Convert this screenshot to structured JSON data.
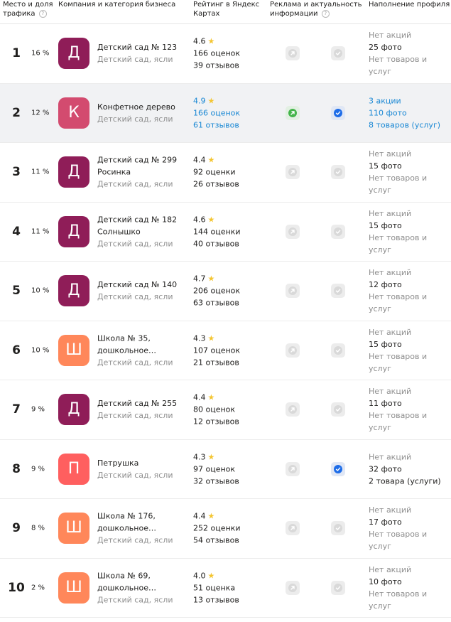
{
  "header": {
    "place_share": "Место и доля трафика",
    "company": "Компания и категория бизнеса",
    "rating": "Рейтинг в Яндекс Картах",
    "ads": "Реклама и актуальность информации",
    "profile": "Наполнение профиля",
    "help_icon": "question-icon"
  },
  "colors": {
    "purple": "#8f1d58",
    "pink": "#d34b6f",
    "orange": "#ff875a",
    "coral": "#ff5f5f",
    "link_blue": "#1a88d4",
    "highlight_bg": "#f1f2f4"
  },
  "rows": [
    {
      "place": "1",
      "share": "16 %",
      "letter": "Д",
      "color": "#8f1d58",
      "name": "Детский сад № 123",
      "category": "Детский сад, ясли",
      "score": "4.6",
      "ratings": "166 оценок",
      "reviews": "39 отзывов",
      "promo": "Нет акций",
      "photos": "25 фото",
      "goods": "Нет товаров и услуг",
      "ad_active": false,
      "verified": false,
      "highlight": false
    },
    {
      "place": "2",
      "share": "12 %",
      "letter": "К",
      "color": "#d34b6f",
      "name": "Конфетное дерево",
      "category": "Детский сад, ясли",
      "score": "4.9",
      "ratings": "166 оценок",
      "reviews": "61 отзывов",
      "promo": "3 акции",
      "photos": "110 фото",
      "goods": "8 товаров (услуг)",
      "ad_active": true,
      "verified": true,
      "highlight": true
    },
    {
      "place": "3",
      "share": "11 %",
      "letter": "Д",
      "color": "#8f1d58",
      "name": "Детский сад № 299 Росинка",
      "category": "Детский сад, ясли",
      "score": "4.4",
      "ratings": "92 оценки",
      "reviews": "26 отзывов",
      "promo": "Нет акций",
      "photos": "15 фото",
      "goods": "Нет товаров и услуг",
      "ad_active": false,
      "verified": false,
      "highlight": false
    },
    {
      "place": "4",
      "share": "11 %",
      "letter": "Д",
      "color": "#8f1d58",
      "name": "Детский сад № 182 Солнышко",
      "category": "Детский сад, ясли",
      "score": "4.6",
      "ratings": "144 оценки",
      "reviews": "40 отзывов",
      "promo": "Нет акций",
      "photos": "15 фото",
      "goods": "Нет товаров и услуг",
      "ad_active": false,
      "verified": false,
      "highlight": false
    },
    {
      "place": "5",
      "share": "10 %",
      "letter": "Д",
      "color": "#8f1d58",
      "name": "Детский сад № 140",
      "category": "Детский сад, ясли",
      "score": "4.7",
      "ratings": "206 оценок",
      "reviews": "63 отзывов",
      "promo": "Нет акций",
      "photos": "12 фото",
      "goods": "Нет товаров и услуг",
      "ad_active": false,
      "verified": false,
      "highlight": false
    },
    {
      "place": "6",
      "share": "10 %",
      "letter": "Ш",
      "color": "#ff875a",
      "name": "Школа № 35, дошкольное…",
      "category": "Детский сад, ясли",
      "score": "4.3",
      "ratings": "107 оценок",
      "reviews": "21 отзывов",
      "promo": "Нет акций",
      "photos": "15 фото",
      "goods": "Нет товаров и услуг",
      "ad_active": false,
      "verified": false,
      "highlight": false
    },
    {
      "place": "7",
      "share": "9 %",
      "letter": "Д",
      "color": "#8f1d58",
      "name": "Детский сад № 255",
      "category": "Детский сад, ясли",
      "score": "4.4",
      "ratings": "80 оценок",
      "reviews": "12 отзывов",
      "promo": "Нет акций",
      "photos": "11 фото",
      "goods": "Нет товаров и услуг",
      "ad_active": false,
      "verified": false,
      "highlight": false
    },
    {
      "place": "8",
      "share": "9 %",
      "letter": "П",
      "color": "#ff5f5f",
      "name": "Петрушка",
      "category": "Детский сад, ясли",
      "score": "4.3",
      "ratings": "97 оценок",
      "reviews": "32 отзывов",
      "promo": "Нет акций",
      "photos": "32 фото",
      "goods": "2 товара (услуги)",
      "ad_active": false,
      "verified": true,
      "highlight": false
    },
    {
      "place": "9",
      "share": "8 %",
      "letter": "Ш",
      "color": "#ff875a",
      "name": "Школа № 176, дошкольное…",
      "category": "Детский сад, ясли",
      "score": "4.4",
      "ratings": "252 оценки",
      "reviews": "54 отзывов",
      "promo": "Нет акций",
      "photos": "17 фото",
      "goods": "Нет товаров и услуг",
      "ad_active": false,
      "verified": false,
      "highlight": false
    },
    {
      "place": "10",
      "share": "2 %",
      "letter": "Ш",
      "color": "#ff875a",
      "name": "Школа № 69, дошкольное…",
      "category": "Детский сад, ясли",
      "score": "4.0",
      "ratings": "51 оценка",
      "reviews": "13 отзывов",
      "promo": "Нет акций",
      "photos": "10 фото",
      "goods": "Нет товаров и услуг",
      "ad_active": false,
      "verified": false,
      "highlight": false
    }
  ]
}
